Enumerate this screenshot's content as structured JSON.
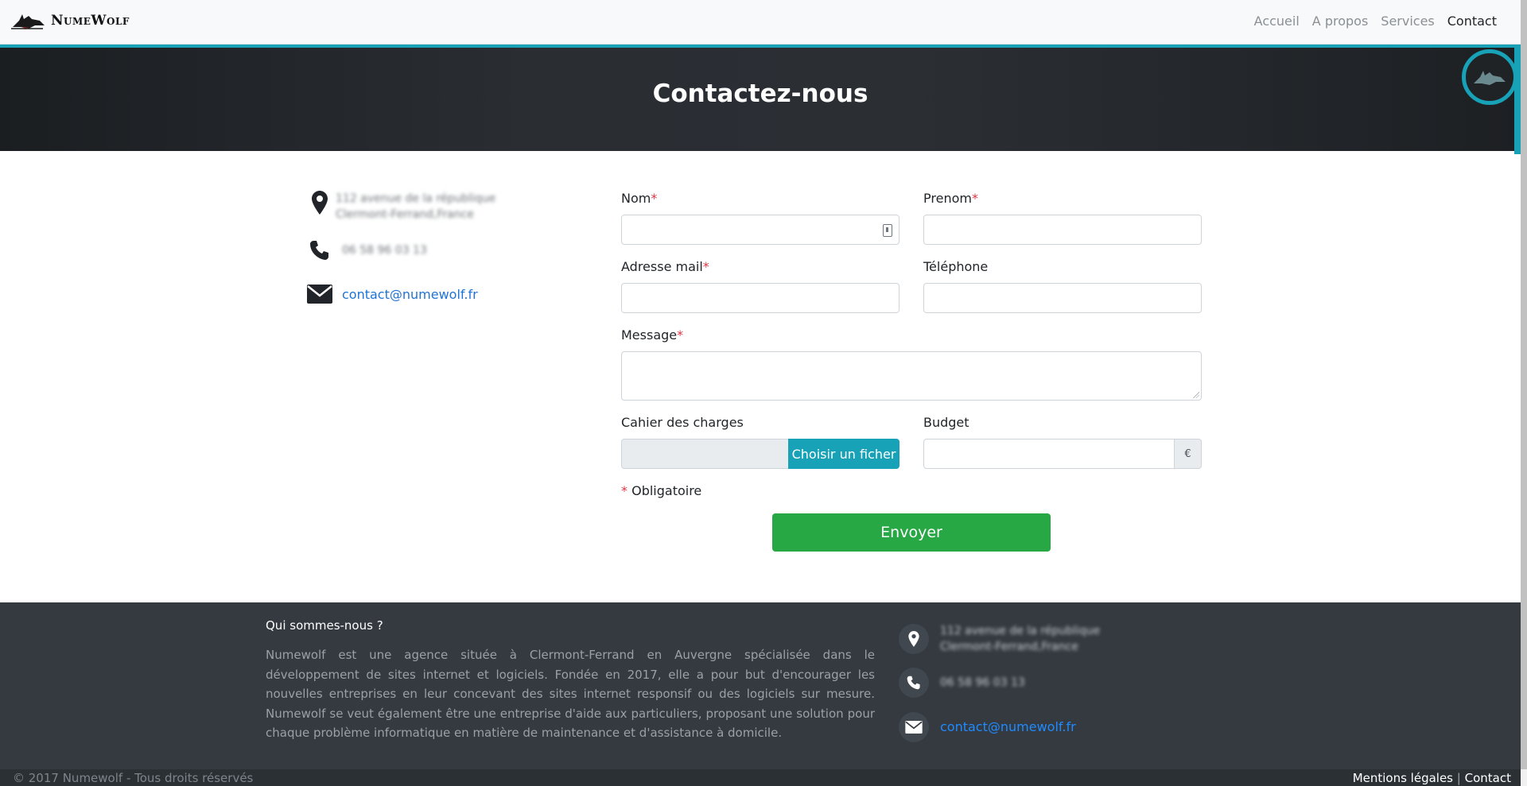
{
  "brand": {
    "name": "NumeWolf"
  },
  "nav": {
    "items": [
      "Accueil",
      "A propos",
      "Services",
      "Contact"
    ],
    "active": "Contact"
  },
  "hero": {
    "title": "Contactez-nous"
  },
  "contact_info": {
    "address_line1": "112 avenue de la république",
    "address_line2": "Clermont-Ferrand,France",
    "phone": "06 58 96 03 13",
    "email": "contact@numewolf.fr"
  },
  "form": {
    "nom_label": "Nom",
    "prenom_label": "Prenom",
    "email_label": "Adresse mail",
    "telephone_label": "Téléphone",
    "message_label": "Message",
    "cahier_label": "Cahier des charges",
    "file_button": "Choisir un ficher",
    "budget_label": "Budget",
    "currency": "€",
    "required_marker": "*",
    "required_note": "Obligatoire",
    "submit": "Envoyer"
  },
  "footer": {
    "title": "Qui sommes-nous ?",
    "text": "Numewolf est une agence située à Clermont-Ferrand en Auvergne spécialisée dans le développement de sites internet et logiciels. Fondée en 2017, elle a pour but d'encourager les nouvelles entreprises en leur concevant des sites internet responsif ou des logiciels sur mesure. Numewolf se veut également être une entreprise d'aide aux particuliers, proposant une solution pour chaque problème informatique en matière de maintenance et d'assistance à domicile.",
    "address_line1": "112 avenue de la république",
    "address_line2": "Clermont-Ferrand,France",
    "phone": "06 58 96 03 13",
    "email": "contact@numewolf.fr",
    "copyright": "© 2017 Numewolf - Tous droits réservés",
    "legal_link": "Mentions légales",
    "separator": "|",
    "contact_link": "Contact"
  },
  "colors": {
    "accent": "#17a2b8",
    "success": "#28a745",
    "dark": "#343a40",
    "link": "#1f73d6"
  }
}
